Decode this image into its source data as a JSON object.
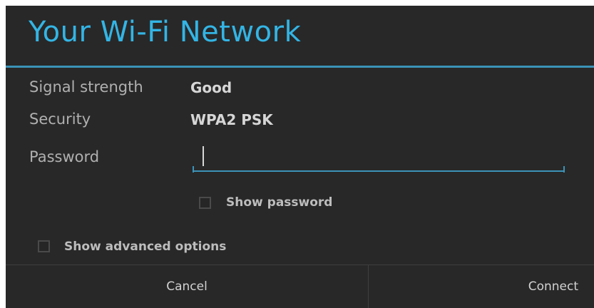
{
  "dialog": {
    "title": "Your Wi-Fi Network",
    "accent_color": "#33b5e5",
    "background_color": "#282828"
  },
  "fields": {
    "signal_label": "Signal strength",
    "signal_value": "Good",
    "security_label": "Security",
    "security_value": "WPA2 PSK",
    "password_label": "Password",
    "password_value": ""
  },
  "options": {
    "show_password_label": "Show password",
    "show_password_checked": false,
    "show_advanced_label": "Show advanced options",
    "show_advanced_checked": false
  },
  "buttons": {
    "cancel_label": "Cancel",
    "connect_label": "Connect"
  }
}
